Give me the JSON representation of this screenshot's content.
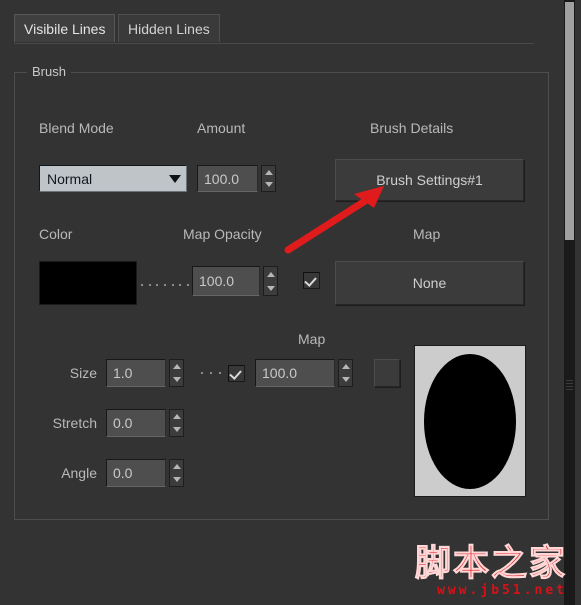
{
  "tabs": [
    {
      "label": "Visibile Lines",
      "active": true
    },
    {
      "label": "Hidden Lines",
      "active": false
    }
  ],
  "group": {
    "title": "Brush"
  },
  "brush": {
    "blend_mode_label": "Blend Mode",
    "blend_mode_value": "Normal",
    "amount_label": "Amount",
    "amount_value": "100.0",
    "brush_details_label": "Brush Details",
    "brush_settings_button": "Brush Settings#1",
    "color_label": "Color",
    "color_value": "#000000",
    "map_opacity_label": "Map Opacity",
    "map_opacity_value": "100.0",
    "map_opacity_enabled": true,
    "map_label": "Map",
    "map_button": "None"
  },
  "map_section": {
    "title": "Map",
    "size_label": "Size",
    "size_value": "1.0",
    "size_map_enabled": true,
    "size_map_amount": "100.0",
    "size_map_button": "",
    "stretch_label": "Stretch",
    "stretch_value": "0.0",
    "angle_label": "Angle",
    "angle_value": "0.0"
  },
  "preview": {
    "shape": "ellipse",
    "shape_color": "#000000",
    "background_color": "#cccccc"
  },
  "annotation": {
    "arrow_color": "#e01b1b"
  },
  "watermark": {
    "name": "脚本之家",
    "url": "www.jb51.net"
  },
  "icons": {
    "combo_arrow": "chevron-down-icon",
    "spinner_up": "spinner-up-icon",
    "spinner_down": "spinner-down-icon",
    "check": "check-icon"
  }
}
